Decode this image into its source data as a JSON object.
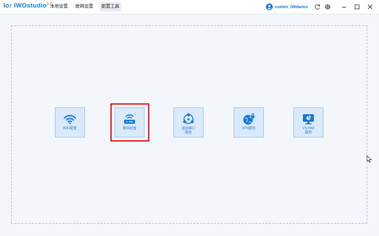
{
  "app": {
    "logo_prefix": "I",
    "logo_brand": "IWOstudio",
    "logo_version": "3.0"
  },
  "nav": [
    {
      "label": "本地设置"
    },
    {
      "label": "联网设置"
    },
    {
      "label": "配置工具"
    }
  ],
  "user": {
    "name": "comm_IWdemo"
  },
  "window_buttons": [
    "refresh-icon",
    "gear-icon",
    "minimize-icon",
    "maximize-icon",
    "close-icon"
  ],
  "cards": [
    {
      "label": "WiFi配置",
      "icon": "wifi-icon"
    },
    {
      "label": "模块配置",
      "icon": "router-icon"
    },
    {
      "label": "虚拟串口\n服务",
      "icon": "network-nodes-icon"
    },
    {
      "label": "VPN服务",
      "icon": "globe-lock-icon"
    },
    {
      "label": "VS-HMI\n服务",
      "icon": "monitor-chart-icon"
    }
  ],
  "colors": {
    "accent": "#1677d8",
    "card_bg": "#dbeafa",
    "highlight": "#e02020"
  }
}
